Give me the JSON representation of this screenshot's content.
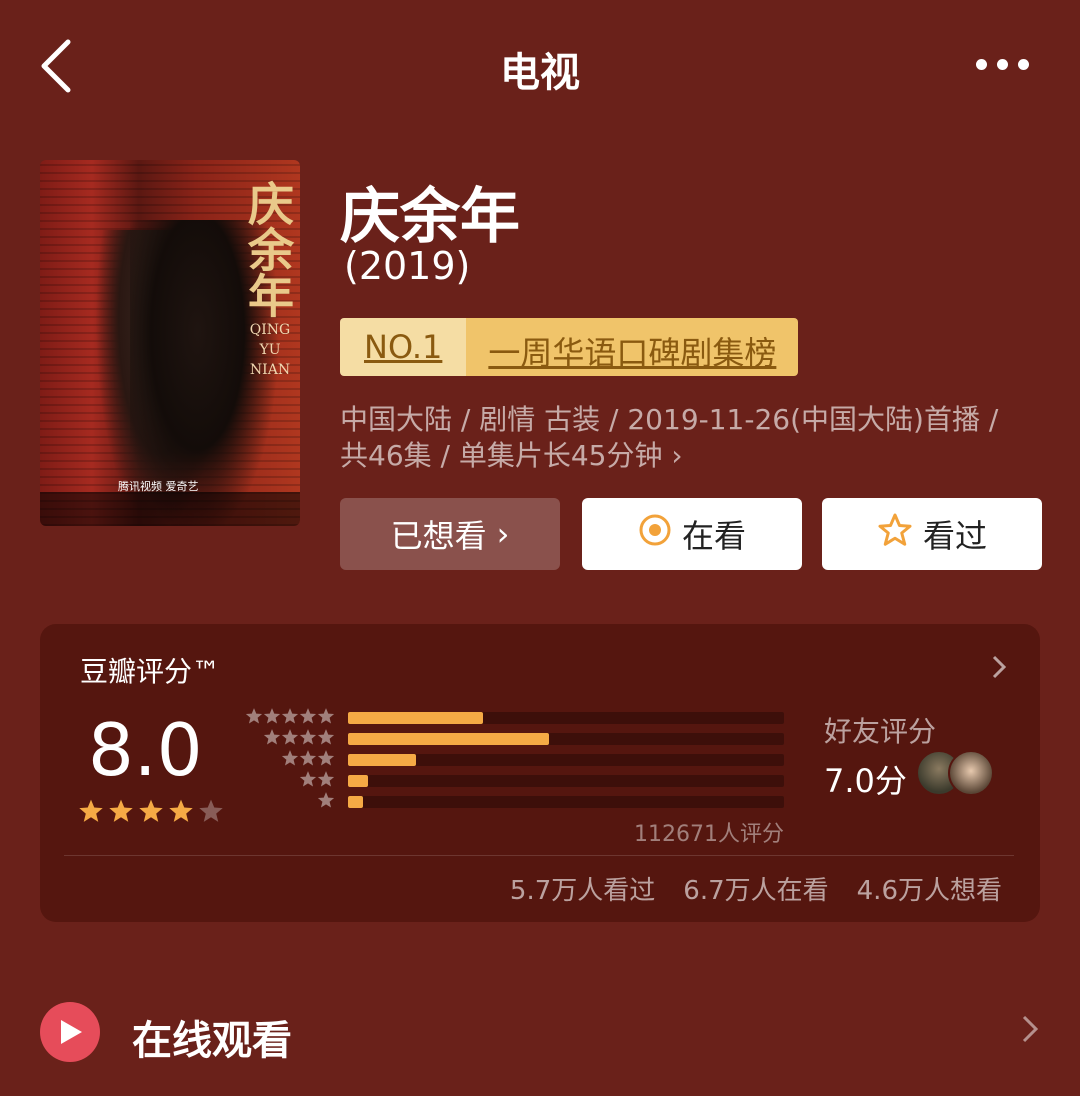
{
  "nav": {
    "title": "电视"
  },
  "poster": {
    "calligraphy": "庆余年",
    "en_title": "QING YU NIAN",
    "logos": "腾讯视频  爱奇艺"
  },
  "movie": {
    "title": "庆余年",
    "year": "(2019)",
    "rank_no": "NO.1",
    "rank_list": "一周华语口碑剧集榜",
    "meta_line1": "中国大陆 / 剧情 古装 / 2019-11-26(中国大陆)首播 /",
    "meta_line2": "共46集 / 单集片长45分钟",
    "meta_arrow": "›"
  },
  "actions": {
    "want_label": "已想看",
    "want_arrow": "›",
    "watching_label": "在看",
    "seen_label": "看过"
  },
  "rating": {
    "title": "豆瓣评分™",
    "score": "8.0",
    "stars": 4,
    "total_label": "112671人评分",
    "distribution": [
      {
        "stars": 5,
        "fraction": 0.31
      },
      {
        "stars": 4,
        "fraction": 0.46
      },
      {
        "stars": 3,
        "fraction": 0.155
      },
      {
        "stars": 2,
        "fraction": 0.045
      },
      {
        "stars": 1,
        "fraction": 0.035
      }
    ],
    "friend_label": "好友评分",
    "friend_score": "7.0分",
    "seen_count": "5.7万人看过",
    "watching_count": "6.7万人在看",
    "want_count": "4.6万人想看"
  },
  "online": {
    "title": "在线观看"
  },
  "colors": {
    "background": "#6a211a",
    "card": "#55160f",
    "star": "#f5aa45",
    "bar": "#f5aa45",
    "play": "#e64c5a",
    "rank_no_bg": "#f5dda4",
    "rank_list_bg": "#f0c46a"
  },
  "icons": {
    "back": "back-chevron-icon",
    "more": "more-dots-icon",
    "watching": "target-circle-icon",
    "seen": "star-outline-icon",
    "online": "play-icon"
  }
}
